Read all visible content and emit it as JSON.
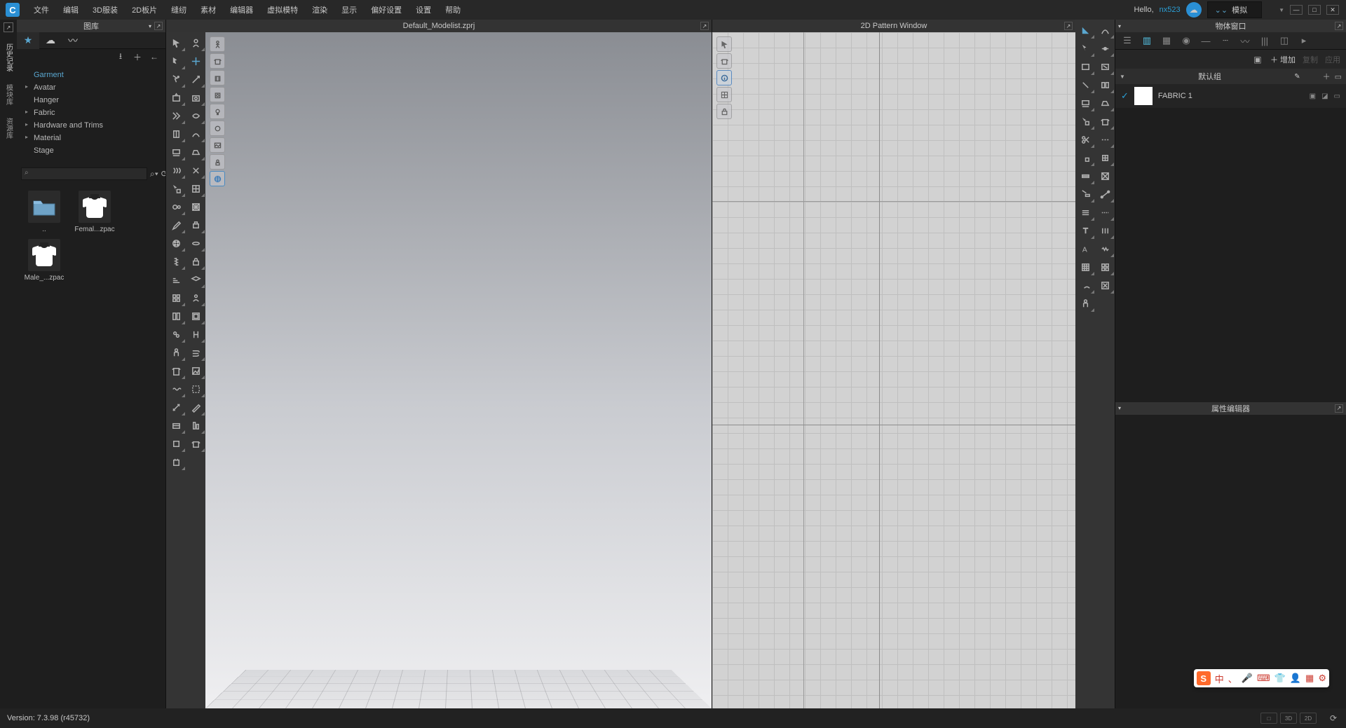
{
  "menubar": {
    "items": [
      "文件",
      "编辑",
      "3D服装",
      "2D板片",
      "缝纫",
      "素材",
      "编辑器",
      "虚拟模特",
      "渲染",
      "显示",
      "偏好设置",
      "设置",
      "帮助"
    ],
    "hello": "Hello,",
    "username": "nx523",
    "simulate": "模拟"
  },
  "left_tabs": [
    "历史记录",
    "模块库",
    "资源库"
  ],
  "library": {
    "title": "图库",
    "tree": [
      {
        "label": "Garment",
        "active": true,
        "leaf": true
      },
      {
        "label": "Avatar"
      },
      {
        "label": "Hanger",
        "leaf": true
      },
      {
        "label": "Fabric"
      },
      {
        "label": "Hardware and Trims"
      },
      {
        "label": "Material"
      },
      {
        "label": "Stage",
        "leaf": true
      }
    ],
    "search_placeholder": "",
    "assets": [
      {
        "name": "..",
        "type": "folder"
      },
      {
        "name": "Femal...zpac",
        "type": "shirt"
      },
      {
        "name": "Male_...zpac",
        "type": "shirt"
      }
    ]
  },
  "viewport_3d": {
    "title": "Default_Modelist.zprj"
  },
  "viewport_2d": {
    "title": "2D Pattern Window"
  },
  "object_panel": {
    "title": "物体窗口",
    "add": "增加",
    "copy": "复制",
    "paste": "应用",
    "default_group": "默认组",
    "fabric": "FABRIC 1"
  },
  "property_panel": {
    "title": "属性编辑器"
  },
  "statusbar": {
    "version": "Version: 7.3.98 (r45732)",
    "modes": [
      "□",
      "3D",
      "2D"
    ]
  },
  "ime": [
    "中",
    "、",
    "",
    "",
    "",
    "",
    "",
    ""
  ]
}
